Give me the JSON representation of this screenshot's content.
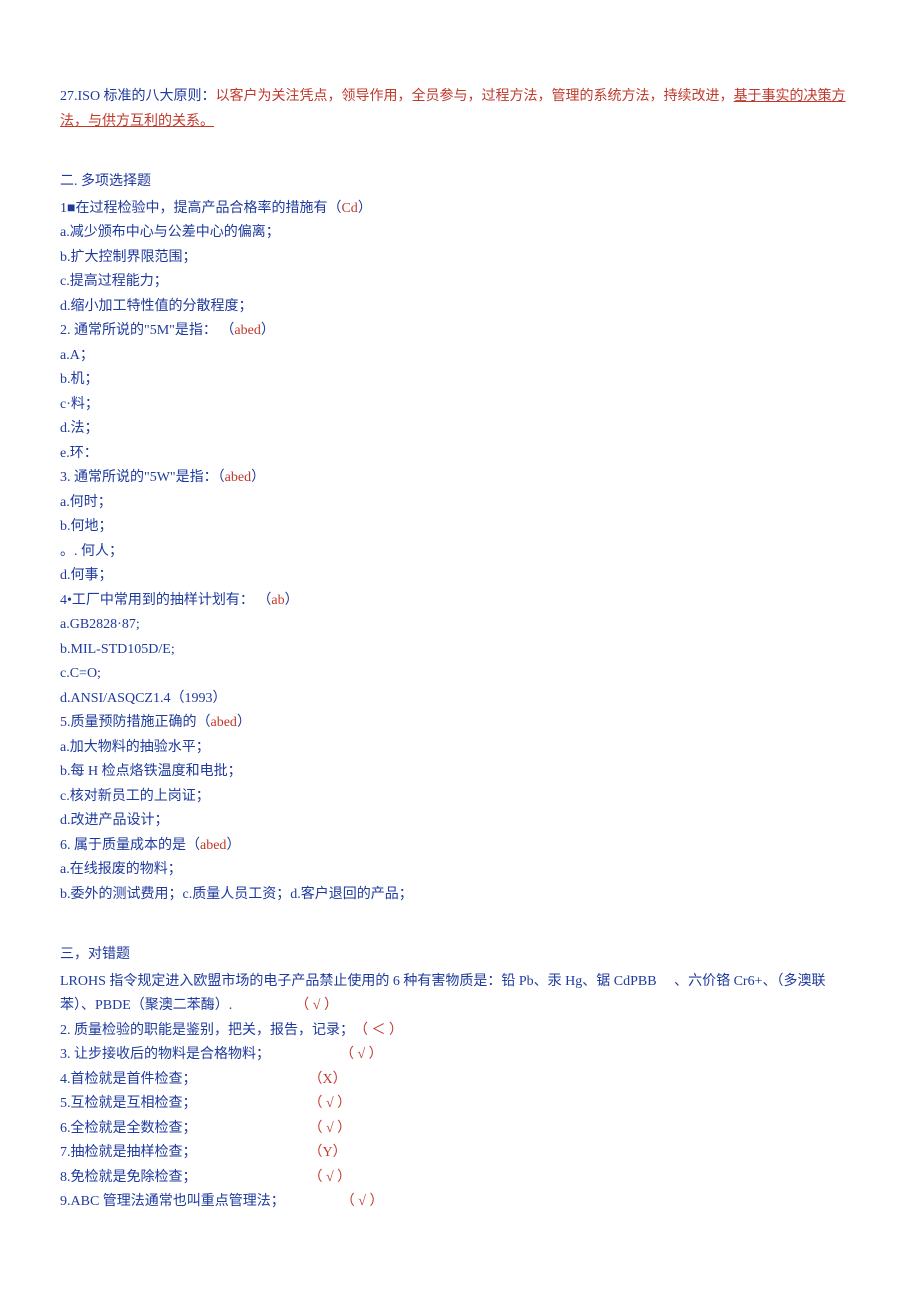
{
  "intro": {
    "prefix": "27.ISO 标准的八大原则：",
    "body": "以客户为关注凭点，领导作用，全员参与，过程方法，管理的系统方法，持续改进，",
    "underlined": "基于事实的决策方法，与供方互利的关系。"
  },
  "section2": {
    "header": "二. 多项选择题",
    "q1": {
      "stem_pre": "1■在过程检验中，提高产品合格率的措施有（",
      "ans": "Cd",
      "stem_post": "）",
      "a": "a.减少颁布中心与公差中心的偏离；",
      "b": "b.扩大控制界限范围；",
      "c": "c.提高过程能力；",
      "d": "d.缩小加工特性值的分散程度；"
    },
    "q2": {
      "stem_pre": "2. 通常所说的\"5M\"是指： （",
      "ans": "abed",
      "stem_post": "）",
      "a": "a.A；",
      "b": "b.机；",
      "c": "c·料；",
      "d": "d.法；",
      "e": "e.环："
    },
    "q3": {
      "stem_pre": "3. 通常所说的\"5W\"是指：（",
      "ans": "abed",
      "stem_post": "）",
      "a": "a.何时；",
      "b": "b.何地；",
      "c": "。. 何人；",
      "d": "d.何事；"
    },
    "q4": {
      "stem_pre": "4•工厂中常用到的抽样计划有： （",
      "ans": "ab",
      "stem_post": "）",
      "a": "a.GB2828·87;",
      "b": "b.MIL-STD105D/E;",
      "c": "c.C=O;",
      "d": "d.ANSI/ASQCZ1.4（1993）"
    },
    "q5": {
      "stem_pre": "5.质量预防措施正确的（",
      "ans": "abed",
      "stem_post": "）",
      "a": "a.加大物料的抽验水平；",
      "b": "b.每 H 检点烙铁温度和电批；",
      "c": "c.核对新员工的上岗证；",
      "d": "d.改进产品设计；"
    },
    "q6": {
      "stem_pre": "6. 属于质量成本的是（",
      "ans": "abed",
      "stem_post": "）",
      "a": "a.在线报废的物料；",
      "b": "b.委外的测试费用；c.质量人员工资；d.客户退回的产品；"
    }
  },
  "section3": {
    "header": "三，对错题",
    "q1": {
      "text": "LROHS 指令规定进入欧盟市场的电子产品禁止使用的 6 种有害物质是：铅 Pb、汞 Hg、锯 CdPBB 　、六价铬 Cr6+、（多澳联苯）、PBDE（聚澳二苯酶）.",
      "mark": "（ √ ）"
    },
    "q2": {
      "text": "2. 质量检验的职能是鉴别，把关，报告，记录；",
      "mark": "（ ＜ ）"
    },
    "q3": {
      "text": "3. 让步接收后的物料是合格物料；",
      "mark": "（ √ ）"
    },
    "q4": {
      "text": "4.首检就是首件检查；",
      "mark": "（X）"
    },
    "q5": {
      "text": "5.互检就是互相检查；",
      "mark": "（ √ ）"
    },
    "q6": {
      "text": "6.全检就是全数检查；",
      "mark": "（ √ ）"
    },
    "q7": {
      "text": "7.抽检就是抽样检查；",
      "mark": "（Y）"
    },
    "q8": {
      "text": "8.免检就是免除检查；",
      "mark": "（ √ ）"
    },
    "q9": {
      "text": "9.ABC 管理法通常也叫重点管理法；",
      "mark": "（ √ ）"
    }
  }
}
